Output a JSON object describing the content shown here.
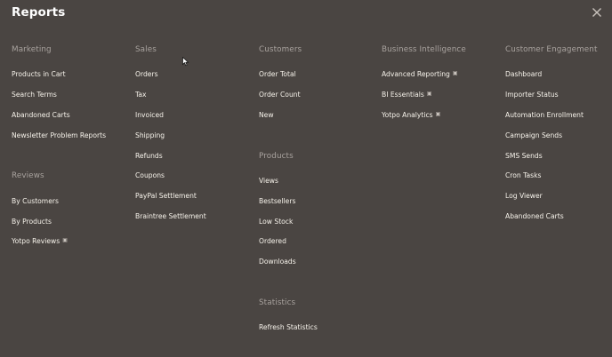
{
  "title": "Reports",
  "close_icon": "close-icon",
  "marketing": {
    "heading": "Marketing",
    "items": [
      "Products in Cart",
      "Search Terms",
      "Abandoned Carts",
      "Newsletter Problem Reports"
    ]
  },
  "reviews": {
    "heading": "Reviews",
    "items": [
      "By Customers",
      "By Products",
      "Yotpo Reviews"
    ]
  },
  "sales": {
    "heading": "Sales",
    "items": [
      "Orders",
      "Tax",
      "Invoiced",
      "Shipping",
      "Refunds",
      "Coupons",
      "PayPal Settlement",
      "Braintree Settlement"
    ]
  },
  "customers": {
    "heading": "Customers",
    "items": [
      "Order Total",
      "Order Count",
      "New"
    ]
  },
  "products": {
    "heading": "Products",
    "items": [
      "Views",
      "Bestsellers",
      "Low Stock",
      "Ordered",
      "Downloads"
    ]
  },
  "statistics": {
    "heading": "Statistics",
    "items": [
      "Refresh Statistics"
    ]
  },
  "business_intelligence": {
    "heading": "Business Intelligence",
    "items": [
      "Advanced Reporting",
      "BI Essentials",
      "Yotpo Analytics"
    ]
  },
  "customer_engagement": {
    "heading": "Customer Engagement",
    "items": [
      "Dashboard",
      "Importer Status",
      "Automation Enrollment",
      "Campaign Sends",
      "SMS Sends",
      "Cron Tasks",
      "Log Viewer",
      "Abandoned Carts"
    ]
  },
  "external_link_icon": "external-link-icon",
  "colors": {
    "background": "#4a4542",
    "heading": "#a8a29e",
    "item": "#f7f3eb"
  }
}
